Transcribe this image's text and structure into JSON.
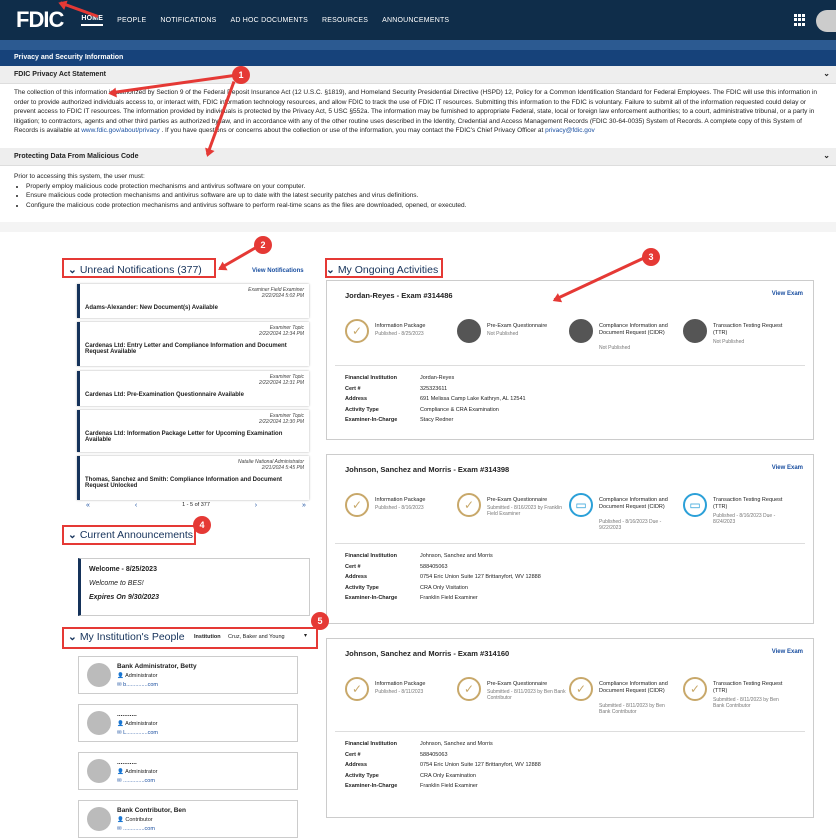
{
  "nav": {
    "logo": "FDIC",
    "items": [
      "HOME",
      "PEOPLE",
      "NOTIFICATIONS",
      "AD HOC DOCUMENTS",
      "RESOURCES",
      "ANNOUNCEMENTS"
    ]
  },
  "privacy": {
    "header": "Privacy and Security Information",
    "act_title": "FDIC Privacy Act Statement",
    "act_text_1": "The collection of this information is authorized by Section 9 of the Federal Deposit Insurance Act (12 U.S.C. §1819), and Homeland Security Presidential Directive (HSPD) 12, Policy for a Common Identification Standard for Federal Employees. The FDIC will use this information in order to provide authorized individuals access to, or interact with, FDIC information technology resources, and allow FDIC to track the use of FDIC IT resources. Submitting this information to the FDIC is voluntary. Failure to submit all of the information requested could delay or prevent access to FDIC IT resources. The information provided by individuals is protected by the Privacy Act, 5 USC §552a. The information may be furnished to appropriate Federal, state, local or foreign law enforcement authorities; to a court, administrative tribunal, or a party in litigation; to contractors, agents and other third parties as authorized by law, and in accordance with any of the other routine uses described in the Identity, Credential and Access Management Records (FDIC 30-64-0035) System of Records. A complete copy of this System of Records is available at",
    "act_link_1": "www.fdic.gov/about/privacy",
    "act_text_2": ". If you have questions or concerns about the collection or use of the information, you may contact the FDIC's Chief Privacy Officer at",
    "act_link_2": "privacy@fdic.gov",
    "mal_title": "Protecting Data From Malicious Code",
    "mal_intro": "Prior to accessing this system, the user must:",
    "mal_items": [
      "Properly employ malicious code protection mechanisms and antivirus software on your computer.",
      "Ensure malicious code protection mechanisms and antivirus software are up to date with the latest security patches and virus definitions.",
      "Configure the malicious code protection mechanisms and antivirus software to perform real-time scans as the files are downloaded, opened, or executed."
    ]
  },
  "notifications": {
    "heading": "Unread Notifications (377)",
    "view_link": "View Notifications",
    "items": [
      {
        "meta1": "Examiner Field Examiner",
        "meta2": "2/22/2024 5:02 PM",
        "title": "Adams-Alexander: New Document(s) Available"
      },
      {
        "meta1": "Examiner Topic",
        "meta2": "2/22/2024 12:34 PM",
        "title": "Cardenas Ltd: Entry Letter and Compliance Information and Document Request Available"
      },
      {
        "meta1": "Examiner Topic",
        "meta2": "2/22/2024 12:31 PM",
        "title": "Cardenas Ltd: Pre-Examination Questionnaire Available"
      },
      {
        "meta1": "Examiner Topic",
        "meta2": "2/22/2024 12:30 PM",
        "title": "Cardenas Ltd: Information Package Letter for Upcoming Examination Available"
      },
      {
        "meta1": "Natalie National Administrator",
        "meta2": "2/21/2024 5:45 PM",
        "title": "Thomas, Sanchez and Smith: Compliance Information and Document Request Unlocked"
      }
    ],
    "pager_text": "1 - 5 of 377"
  },
  "announcements": {
    "heading": "Current Announcements",
    "title": "Welcome - 8/25/2023",
    "body": "Welcome to BES!",
    "expires": "Expires On 9/30/2023"
  },
  "people": {
    "heading": "My Institution's People",
    "institution_label": "Institution",
    "institution_value": "Cruz, Baker and Young",
    "items": [
      {
        "name": "Bank Administrator, Betty",
        "role": "Administrator",
        "email": "b..............com"
      },
      {
        "name": "...........",
        "role": "Administrator",
        "email": "L..............com"
      },
      {
        "name": "...........",
        "role": "Administrator",
        "email": "..............com"
      },
      {
        "name": "Bank Contributor, Ben",
        "role": "Contributor",
        "email": "..............com"
      }
    ]
  },
  "activities": {
    "heading": "My Ongoing Activities",
    "view_exam": "View Exam",
    "labels": [
      "Financial Institution",
      "Cert #",
      "Address",
      "Activity Type",
      "Examiner-In-Charge"
    ],
    "cards": [
      {
        "title": "Jordan-Reyes - Exam #314486",
        "steps": [
          {
            "name": "Information Package",
            "status": "Published - 8/25/2023",
            "icon": "check"
          },
          {
            "name": "Pre-Exam Questionnaire",
            "status": "Not Published",
            "icon": "person"
          },
          {
            "name": "Compliance Information and Document Request (CIDR)",
            "status": "Not Published",
            "icon": "person"
          },
          {
            "name": "Transaction Testing Request (TTR)",
            "status": "Not Published",
            "icon": "person"
          }
        ],
        "details": [
          "Jordan-Reyes",
          "325323611",
          "691 Melissa Camp Lake Kathryn, AL 12541",
          "Compliance & CRA Examination",
          "Stacy Redner"
        ]
      },
      {
        "title": "Johnson, Sanchez and Morris - Exam #314398",
        "steps": [
          {
            "name": "Information Package",
            "status": "Published - 8/16/2023",
            "icon": "check"
          },
          {
            "name": "Pre-Exam Questionnaire",
            "status": "Submitted - 8/16/2023 by Franklin Field Examiner",
            "icon": "check"
          },
          {
            "name": "Compliance Information and Document Request (CIDR)",
            "status": "Published - 8/16/2023 Due - 9/22/2023",
            "icon": "doc"
          },
          {
            "name": "Transaction Testing Request (TTR)",
            "status": "Published - 8/16/2023 Due - 8/24/2023",
            "icon": "doc"
          }
        ],
        "details": [
          "Johnson, Sanchez and Morris",
          "588405063",
          "0754 Eric Union Suite 127 Brittanyfort, WV 12888",
          "CRA Only Visitation",
          "Franklin Field Examiner"
        ]
      },
      {
        "title": "Johnson, Sanchez and Morris - Exam #314160",
        "steps": [
          {
            "name": "Information Package",
            "status": "Published - 8/11/2023",
            "icon": "check"
          },
          {
            "name": "Pre-Exam Questionnaire",
            "status": "Submitted - 8/11/2023 by Ben Bank Contributor",
            "icon": "check"
          },
          {
            "name": "Compliance Information and Document Request (CIDR)",
            "status": "Submitted - 8/11/2023 by Ben Bank Contributor",
            "icon": "check"
          },
          {
            "name": "Transaction Testing Request (TTR)",
            "status": "Submitted - 8/11/2023 by Ben Bank Contributor",
            "icon": "check"
          }
        ],
        "details": [
          "Johnson, Sanchez and Morris",
          "588405063",
          "0754 Eric Union Suite 127 Brittanyfort, WV 12888",
          "CRA Only Examination",
          "Franklin Field Examiner"
        ]
      }
    ]
  },
  "callouts": [
    "1",
    "2",
    "3",
    "4",
    "5"
  ],
  "colors": {
    "navy": "#0f2d4a",
    "accent": "#e53935",
    "gold": "#c8a86a",
    "link": "#1a4fa0"
  }
}
